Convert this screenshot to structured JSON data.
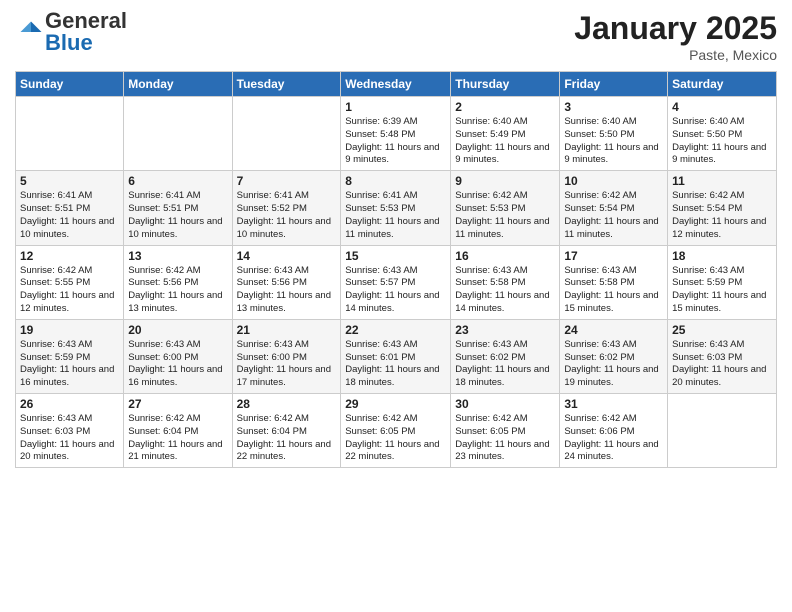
{
  "logo": {
    "general": "General",
    "blue": "Blue"
  },
  "header": {
    "title": "January 2025",
    "location": "Paste, Mexico"
  },
  "weekdays": [
    "Sunday",
    "Monday",
    "Tuesday",
    "Wednesday",
    "Thursday",
    "Friday",
    "Saturday"
  ],
  "weeks": [
    [
      {
        "day": "",
        "info": ""
      },
      {
        "day": "",
        "info": ""
      },
      {
        "day": "",
        "info": ""
      },
      {
        "day": "1",
        "info": "Sunrise: 6:39 AM\nSunset: 5:48 PM\nDaylight: 11 hours and 9 minutes."
      },
      {
        "day": "2",
        "info": "Sunrise: 6:40 AM\nSunset: 5:49 PM\nDaylight: 11 hours and 9 minutes."
      },
      {
        "day": "3",
        "info": "Sunrise: 6:40 AM\nSunset: 5:50 PM\nDaylight: 11 hours and 9 minutes."
      },
      {
        "day": "4",
        "info": "Sunrise: 6:40 AM\nSunset: 5:50 PM\nDaylight: 11 hours and 9 minutes."
      }
    ],
    [
      {
        "day": "5",
        "info": "Sunrise: 6:41 AM\nSunset: 5:51 PM\nDaylight: 11 hours and 10 minutes."
      },
      {
        "day": "6",
        "info": "Sunrise: 6:41 AM\nSunset: 5:51 PM\nDaylight: 11 hours and 10 minutes."
      },
      {
        "day": "7",
        "info": "Sunrise: 6:41 AM\nSunset: 5:52 PM\nDaylight: 11 hours and 10 minutes."
      },
      {
        "day": "8",
        "info": "Sunrise: 6:41 AM\nSunset: 5:53 PM\nDaylight: 11 hours and 11 minutes."
      },
      {
        "day": "9",
        "info": "Sunrise: 6:42 AM\nSunset: 5:53 PM\nDaylight: 11 hours and 11 minutes."
      },
      {
        "day": "10",
        "info": "Sunrise: 6:42 AM\nSunset: 5:54 PM\nDaylight: 11 hours and 11 minutes."
      },
      {
        "day": "11",
        "info": "Sunrise: 6:42 AM\nSunset: 5:54 PM\nDaylight: 11 hours and 12 minutes."
      }
    ],
    [
      {
        "day": "12",
        "info": "Sunrise: 6:42 AM\nSunset: 5:55 PM\nDaylight: 11 hours and 12 minutes."
      },
      {
        "day": "13",
        "info": "Sunrise: 6:42 AM\nSunset: 5:56 PM\nDaylight: 11 hours and 13 minutes."
      },
      {
        "day": "14",
        "info": "Sunrise: 6:43 AM\nSunset: 5:56 PM\nDaylight: 11 hours and 13 minutes."
      },
      {
        "day": "15",
        "info": "Sunrise: 6:43 AM\nSunset: 5:57 PM\nDaylight: 11 hours and 14 minutes."
      },
      {
        "day": "16",
        "info": "Sunrise: 6:43 AM\nSunset: 5:58 PM\nDaylight: 11 hours and 14 minutes."
      },
      {
        "day": "17",
        "info": "Sunrise: 6:43 AM\nSunset: 5:58 PM\nDaylight: 11 hours and 15 minutes."
      },
      {
        "day": "18",
        "info": "Sunrise: 6:43 AM\nSunset: 5:59 PM\nDaylight: 11 hours and 15 minutes."
      }
    ],
    [
      {
        "day": "19",
        "info": "Sunrise: 6:43 AM\nSunset: 5:59 PM\nDaylight: 11 hours and 16 minutes."
      },
      {
        "day": "20",
        "info": "Sunrise: 6:43 AM\nSunset: 6:00 PM\nDaylight: 11 hours and 16 minutes."
      },
      {
        "day": "21",
        "info": "Sunrise: 6:43 AM\nSunset: 6:00 PM\nDaylight: 11 hours and 17 minutes."
      },
      {
        "day": "22",
        "info": "Sunrise: 6:43 AM\nSunset: 6:01 PM\nDaylight: 11 hours and 18 minutes."
      },
      {
        "day": "23",
        "info": "Sunrise: 6:43 AM\nSunset: 6:02 PM\nDaylight: 11 hours and 18 minutes."
      },
      {
        "day": "24",
        "info": "Sunrise: 6:43 AM\nSunset: 6:02 PM\nDaylight: 11 hours and 19 minutes."
      },
      {
        "day": "25",
        "info": "Sunrise: 6:43 AM\nSunset: 6:03 PM\nDaylight: 11 hours and 20 minutes."
      }
    ],
    [
      {
        "day": "26",
        "info": "Sunrise: 6:43 AM\nSunset: 6:03 PM\nDaylight: 11 hours and 20 minutes."
      },
      {
        "day": "27",
        "info": "Sunrise: 6:42 AM\nSunset: 6:04 PM\nDaylight: 11 hours and 21 minutes."
      },
      {
        "day": "28",
        "info": "Sunrise: 6:42 AM\nSunset: 6:04 PM\nDaylight: 11 hours and 22 minutes."
      },
      {
        "day": "29",
        "info": "Sunrise: 6:42 AM\nSunset: 6:05 PM\nDaylight: 11 hours and 22 minutes."
      },
      {
        "day": "30",
        "info": "Sunrise: 6:42 AM\nSunset: 6:05 PM\nDaylight: 11 hours and 23 minutes."
      },
      {
        "day": "31",
        "info": "Sunrise: 6:42 AM\nSunset: 6:06 PM\nDaylight: 11 hours and 24 minutes."
      },
      {
        "day": "",
        "info": ""
      }
    ]
  ]
}
